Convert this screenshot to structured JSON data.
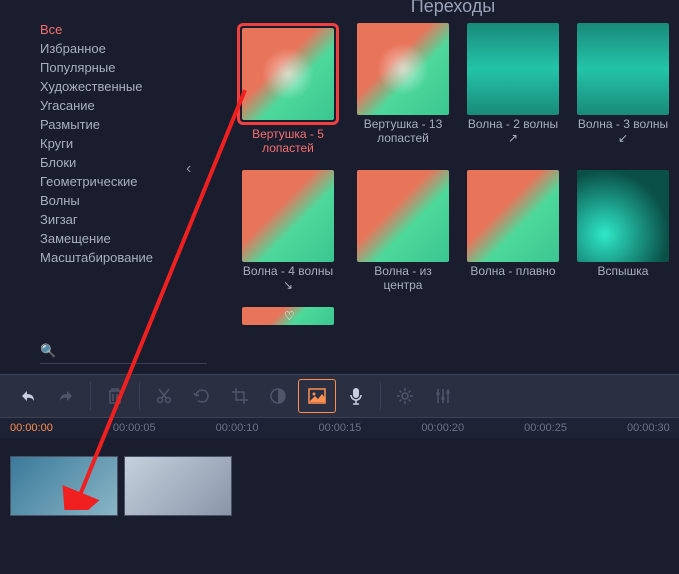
{
  "title": "Переходы",
  "sidebar": {
    "categories": [
      {
        "label": "Все",
        "active": true
      },
      {
        "label": "Избранное"
      },
      {
        "label": "Популярные"
      },
      {
        "label": "Художественные"
      },
      {
        "label": "Угасание"
      },
      {
        "label": "Размытие"
      },
      {
        "label": "Круги"
      },
      {
        "label": "Блоки"
      },
      {
        "label": "Геометрические"
      },
      {
        "label": "Волны"
      },
      {
        "label": "Зигзаг"
      },
      {
        "label": "Замещение"
      },
      {
        "label": "Масштабирование"
      }
    ],
    "search_placeholder": ""
  },
  "transitions": [
    {
      "label": "Вертушка - 5 лопастей",
      "active": true,
      "cls": "swirl"
    },
    {
      "label": "Вертушка - 13 лопастей",
      "cls": "swirl"
    },
    {
      "label": "Волна - 2 волны ↗",
      "cls": "wave"
    },
    {
      "label": "Волна - 3 волны ↙",
      "cls": "wave"
    },
    {
      "label": "Волна - 4 волны ↘",
      "cls": ""
    },
    {
      "label": "Волна - из центра",
      "cls": ""
    },
    {
      "label": "Волна - плавно",
      "cls": ""
    },
    {
      "label": "Вспышка",
      "cls": "fiber"
    }
  ],
  "toolbar": {
    "undo": "↶",
    "redo": "↷",
    "delete": "🗑",
    "cut": "✂",
    "rotate": "↻",
    "crop": "▢",
    "adjust": "◐",
    "image": "▣",
    "mic": "🎤",
    "gear": "⚙",
    "sliders": "⚙"
  },
  "ruler": [
    "00:00:00",
    "00:00:05",
    "00:00:10",
    "00:00:15",
    "00:00:20",
    "00:00:25",
    "00:00:30"
  ]
}
